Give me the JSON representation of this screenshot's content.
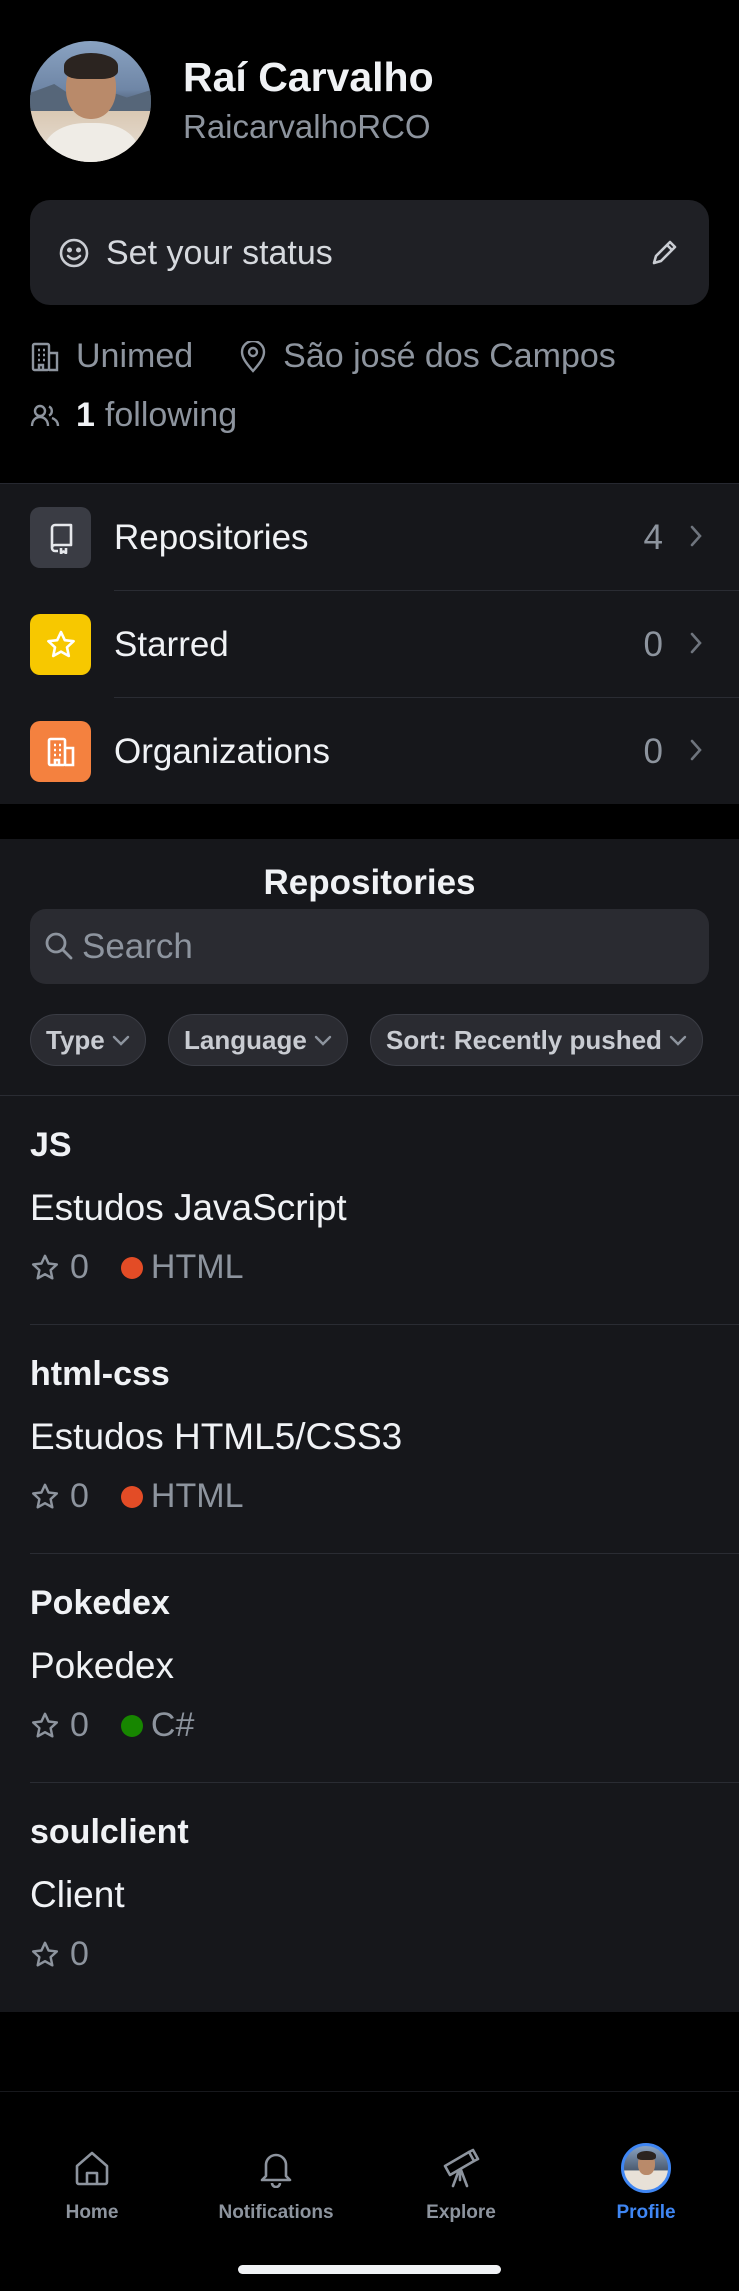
{
  "profile": {
    "name": "Raí Carvalho",
    "login": "RaicarvalhoRCO",
    "status_placeholder": "Set your status",
    "company": "Unimed",
    "location": "São josé dos Campos",
    "following_count": "1",
    "following_label": "following"
  },
  "menu": {
    "items": [
      {
        "label": "Repositories",
        "count": "4",
        "icon": "repo-icon",
        "color": "#3a3c44"
      },
      {
        "label": "Starred",
        "count": "0",
        "icon": "star-icon",
        "color": "#f7c800"
      },
      {
        "label": "Organizations",
        "count": "0",
        "icon": "organization-icon",
        "color": "#f4813f"
      }
    ]
  },
  "repositories": {
    "title": "Repositories",
    "search_placeholder": "Search",
    "filters": {
      "type": "Type",
      "language": "Language",
      "sort": "Sort: Recently pushed"
    },
    "list": [
      {
        "name": "JS",
        "description": "Estudos JavaScript",
        "stars": "0",
        "language": "HTML",
        "language_color": "#e34c26"
      },
      {
        "name": "html-css",
        "description": "Estudos HTML5/CSS3",
        "stars": "0",
        "language": "HTML",
        "language_color": "#e34c26"
      },
      {
        "name": "Pokedex",
        "description": "Pokedex",
        "stars": "0",
        "language": "C#",
        "language_color": "#178600"
      },
      {
        "name": "soulclient",
        "description": "Client",
        "stars": "0",
        "language": "",
        "language_color": ""
      }
    ]
  },
  "tabbar": {
    "home": "Home",
    "notifications": "Notifications",
    "explore": "Explore",
    "profile": "Profile",
    "active": "profile",
    "accent": "#3f86f3"
  }
}
